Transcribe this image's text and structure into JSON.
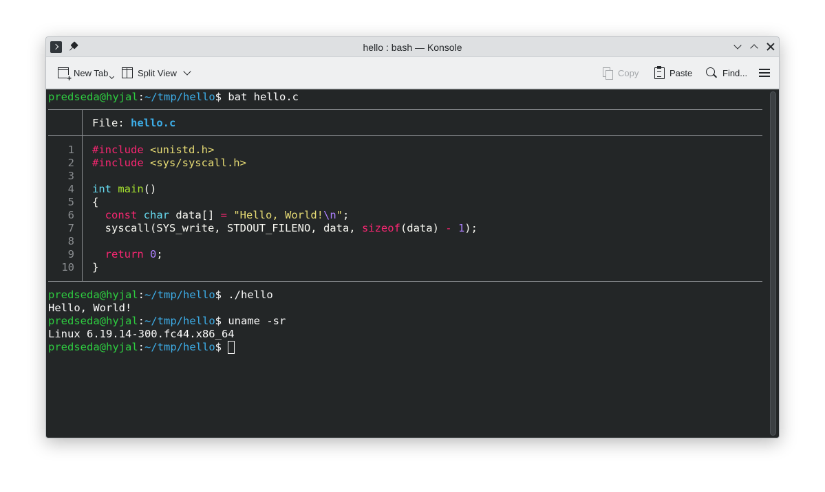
{
  "window": {
    "title": "hello : bash — Konsole"
  },
  "toolbar": {
    "new_tab": "New Tab",
    "split_view": "Split View",
    "copy": "Copy",
    "paste": "Paste",
    "find": "Find..."
  },
  "colors": {
    "prompt_user": "#2ecc40",
    "prompt_path": "#3daee9",
    "terminal_bg": "#232627"
  },
  "terminal": {
    "prompt": {
      "user_host": "predseda@hyjal",
      "colon": ":",
      "path": "~/tmp/hello",
      "dollar": "$"
    },
    "cmd1": " bat hello.c",
    "file_label": "File: ",
    "file_name": "hello.c",
    "line_numbers": [
      "1",
      "2",
      "3",
      "4",
      "5",
      "6",
      "7",
      "8",
      "9",
      "10"
    ],
    "code": {
      "l1_kw": "#include",
      "l1_hdr": " <unistd.h>",
      "l2_kw": "#include",
      "l2_hdr": " <sys/syscall.h>",
      "l4_type": "int",
      "l4_fn": " main",
      "l4_rest": "()",
      "l5": "{",
      "l6_indent": "  ",
      "l6_const": "const",
      "l6_char": " char",
      "l6_var": " data[] ",
      "l6_eq": "=",
      "l6_str1": " \"Hello, World!",
      "l6_esc": "\\n",
      "l6_str2": "\"",
      "l6_semi": ";",
      "l7_a": "  syscall(SYS_write, STDOUT_FILENO, data, ",
      "l7_sizeof": "sizeof",
      "l7_b": "(data) ",
      "l7_minus": "-",
      "l7_sp": " ",
      "l7_one": "1",
      "l7_c": ");",
      "l9_indent": "  ",
      "l9_return": "return",
      "l9_sp": " ",
      "l9_zero": "0",
      "l9_semi": ";",
      "l10": "}"
    },
    "cmd2": " ./hello",
    "out2": "Hello, World!",
    "cmd3": " uname -sr",
    "out3": "Linux 6.19.14-300.fc44.x86_64"
  }
}
